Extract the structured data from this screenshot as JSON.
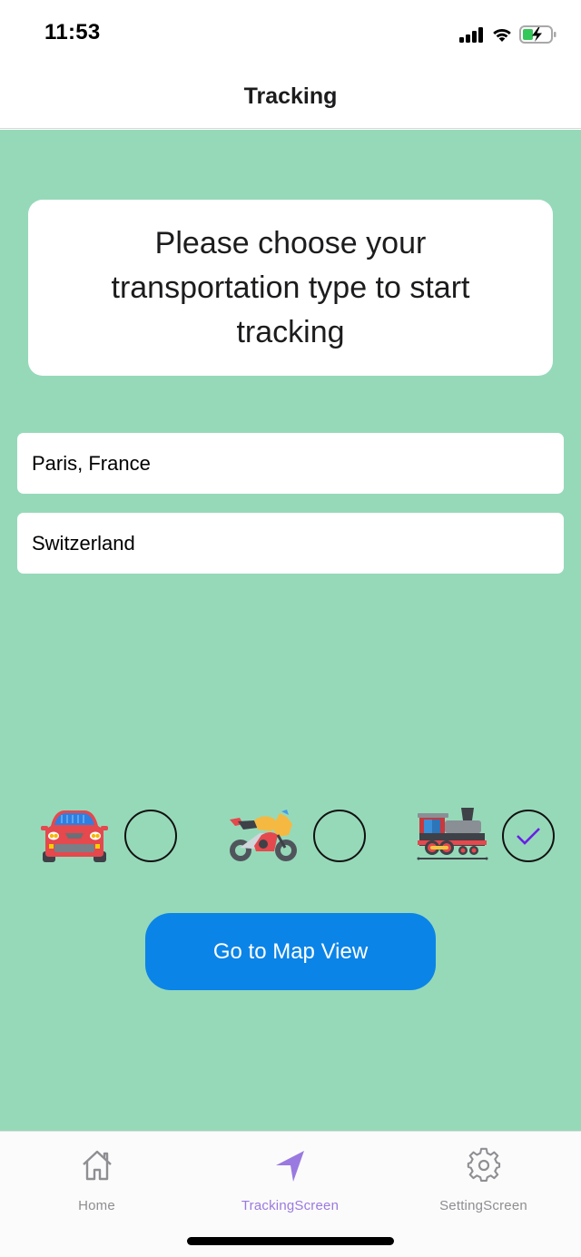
{
  "status_bar": {
    "time": "11:53",
    "icons": [
      "cellular-signal-icon",
      "wifi-icon",
      "battery-charging-icon"
    ],
    "battery_color": "#34c759"
  },
  "header": {
    "title": "Tracking"
  },
  "main": {
    "background_color": "#96d9b9",
    "prompt": "Please choose your transportation type to start tracking",
    "origin_field": {
      "value": "Paris, France",
      "placeholder": ""
    },
    "destination_field": {
      "value": "Switzerland",
      "placeholder": ""
    },
    "transport_options": [
      {
        "name": "Car",
        "icon": "car-icon",
        "selected": false
      },
      {
        "name": "Motorcycle",
        "icon": "motorcycle-icon",
        "selected": false
      },
      {
        "name": "Train",
        "icon": "train-icon",
        "selected": true
      }
    ],
    "check_color": "#6a1ee6",
    "map_button_label": "Go to Map View",
    "map_button_color": "#0b84e8"
  },
  "tab_bar": {
    "active_color": "#9a7ae0",
    "inactive_color": "#8e8e93",
    "tabs": [
      {
        "label": "Home",
        "icon": "home-icon",
        "active": false
      },
      {
        "label": "TrackingScreen",
        "icon": "navigation-arrow-icon",
        "active": true
      },
      {
        "label": "SettingScreen",
        "icon": "gear-icon",
        "active": false
      }
    ]
  }
}
